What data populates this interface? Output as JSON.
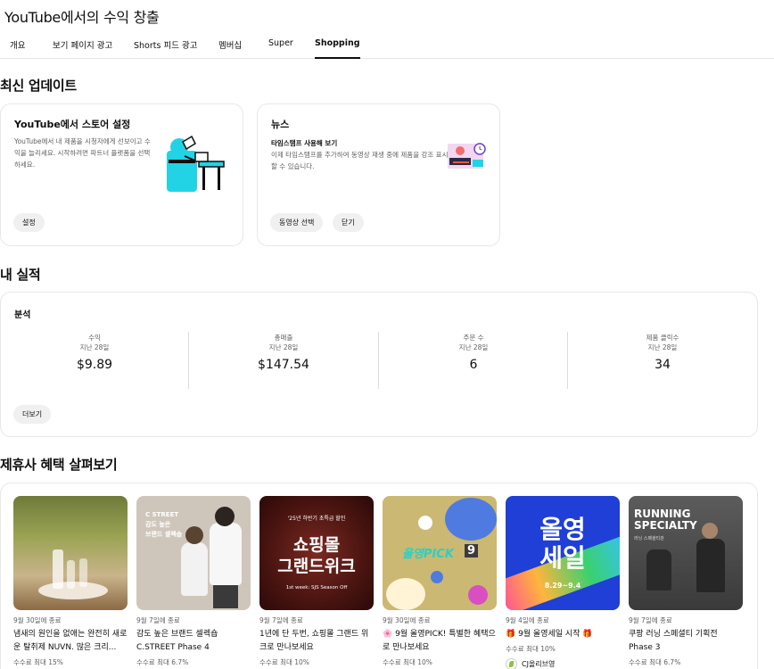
{
  "header": {
    "title": "YouTube에서의 수익 창출"
  },
  "tabs": [
    {
      "label": "개요"
    },
    {
      "label": "보기 페이지 광고"
    },
    {
      "label": "Shorts 피드 광고"
    },
    {
      "label": "멤버십"
    },
    {
      "label": "Super"
    },
    {
      "label": "Shopping"
    }
  ],
  "latest": {
    "title": "최신 업데이트",
    "store_card": {
      "title": "YouTube에서 스토어 설정",
      "desc": "YouTube에서 내 제품을 시청자에게 선보이고 수익을 늘리세요. 시작하려면 파트너 플랫폼을 선택하세요.",
      "button": "설정",
      "illustration_icon": "store-setup-illustration-icon"
    },
    "news_card": {
      "title": "뉴스",
      "subtitle": "타임스탬프 사용해 보기",
      "desc": "이제 타임스탬프를 추가하여 동영상 재생 중에 제품을 강조 표시할 수 있습니다.",
      "button_select": "동영상 선택",
      "button_close": "닫기",
      "illustration_icon": "timestamp-illustration-icon"
    }
  },
  "performance": {
    "title": "내 실적",
    "card_title": "분석",
    "more_button": "더보기",
    "metrics": [
      {
        "label": "수익",
        "period": "지난 28일",
        "value": "$9.89"
      },
      {
        "label": "총매출",
        "period": "지난 28일",
        "value": "$147.54"
      },
      {
        "label": "주문 수",
        "period": "지난 28일",
        "value": "6"
      },
      {
        "label": "제품 클릭수",
        "period": "지난 28일",
        "value": "34"
      }
    ]
  },
  "offers": {
    "title": "제휴사 혜택 살펴보기",
    "items": [
      {
        "date": "9월 30일에 종료",
        "name": "냄새의 원인을 없애는 완전히 새로운 탈취제 NUVN. 많은 크리...",
        "fee": "수수료 최대 15%"
      },
      {
        "date": "9월 7일에 종료",
        "name": "감도 높은 브랜드 셀렉숍 C.STREET Phase 4",
        "fee": "수수료 최대 6.7%",
        "thumb_text": [
          "C STREET",
          "감도 높은",
          "브랜드 셀렉숍"
        ]
      },
      {
        "date": "9월 7일에 종료",
        "name": "1년에 단 두번, 쇼핑몰 그랜드 위크로 만나보세요",
        "fee": "수수료 최대 10%",
        "thumb_text": [
          "'25년 하반기 초특급 할인",
          "쇼핑몰",
          "그랜드위크",
          "1st week: SJS Season Off"
        ]
      },
      {
        "date": "9월 30일에 종료",
        "name": "🌸 9월 올영PICK! 특별한 혜택으로 만나보세요",
        "fee": "수수료 최대 10%",
        "thumb_text": [
          "올영PICK",
          "9"
        ]
      },
      {
        "date": "9월 4일에 종료",
        "name": "🎁 9월 올영세일 시작 🎁",
        "fee": "수수료 최대 10%",
        "brand": "CJ올리브영",
        "thumb_text": [
          "올영",
          "세일",
          "8.29~9.4"
        ]
      },
      {
        "date": "9월 7일에 종료",
        "name": "쿠팡 러닝 스페셜티 기획전 Phase 3",
        "fee": "수수료 최대 6.7%",
        "thumb_text": [
          "RUNNING",
          "SPECIALTY",
          "러닝 스페셜티관"
        ]
      }
    ]
  },
  "colors": {
    "accent_cyan": "#22d3e6",
    "oliveyoung_blue": "#2047d8",
    "oliveyoung_green": "#8cc63f"
  }
}
